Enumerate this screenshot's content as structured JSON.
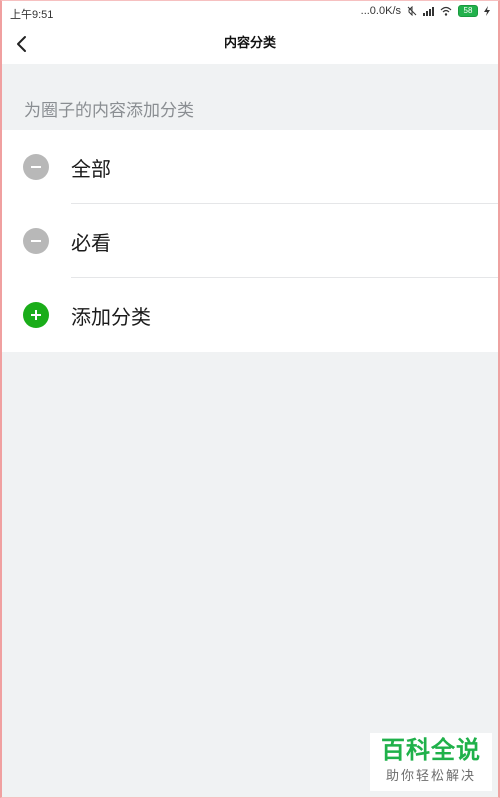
{
  "status_bar": {
    "time": "上午9:51",
    "network_speed": "...0.0K/s",
    "battery_level": "58"
  },
  "navbar": {
    "title": "内容分类"
  },
  "section": {
    "title": "为圈子的内容添加分类"
  },
  "categories": [
    {
      "label": "全部",
      "action": "remove",
      "icon": "minus-circle-icon",
      "icon_color": "#b8b8b8"
    },
    {
      "label": "必看",
      "action": "remove",
      "icon": "minus-circle-icon",
      "icon_color": "#b8b8b8"
    },
    {
      "label": "添加分类",
      "action": "add",
      "icon": "plus-circle-icon",
      "icon_color": "#1aad19"
    }
  ],
  "watermark": {
    "title": "百科全说",
    "subtitle": "助你轻松解决"
  },
  "colors": {
    "background": "#f0f2f3",
    "accent_green": "#1aad19",
    "muted_text": "#8a8e92",
    "remove_gray": "#b8b8b8"
  }
}
